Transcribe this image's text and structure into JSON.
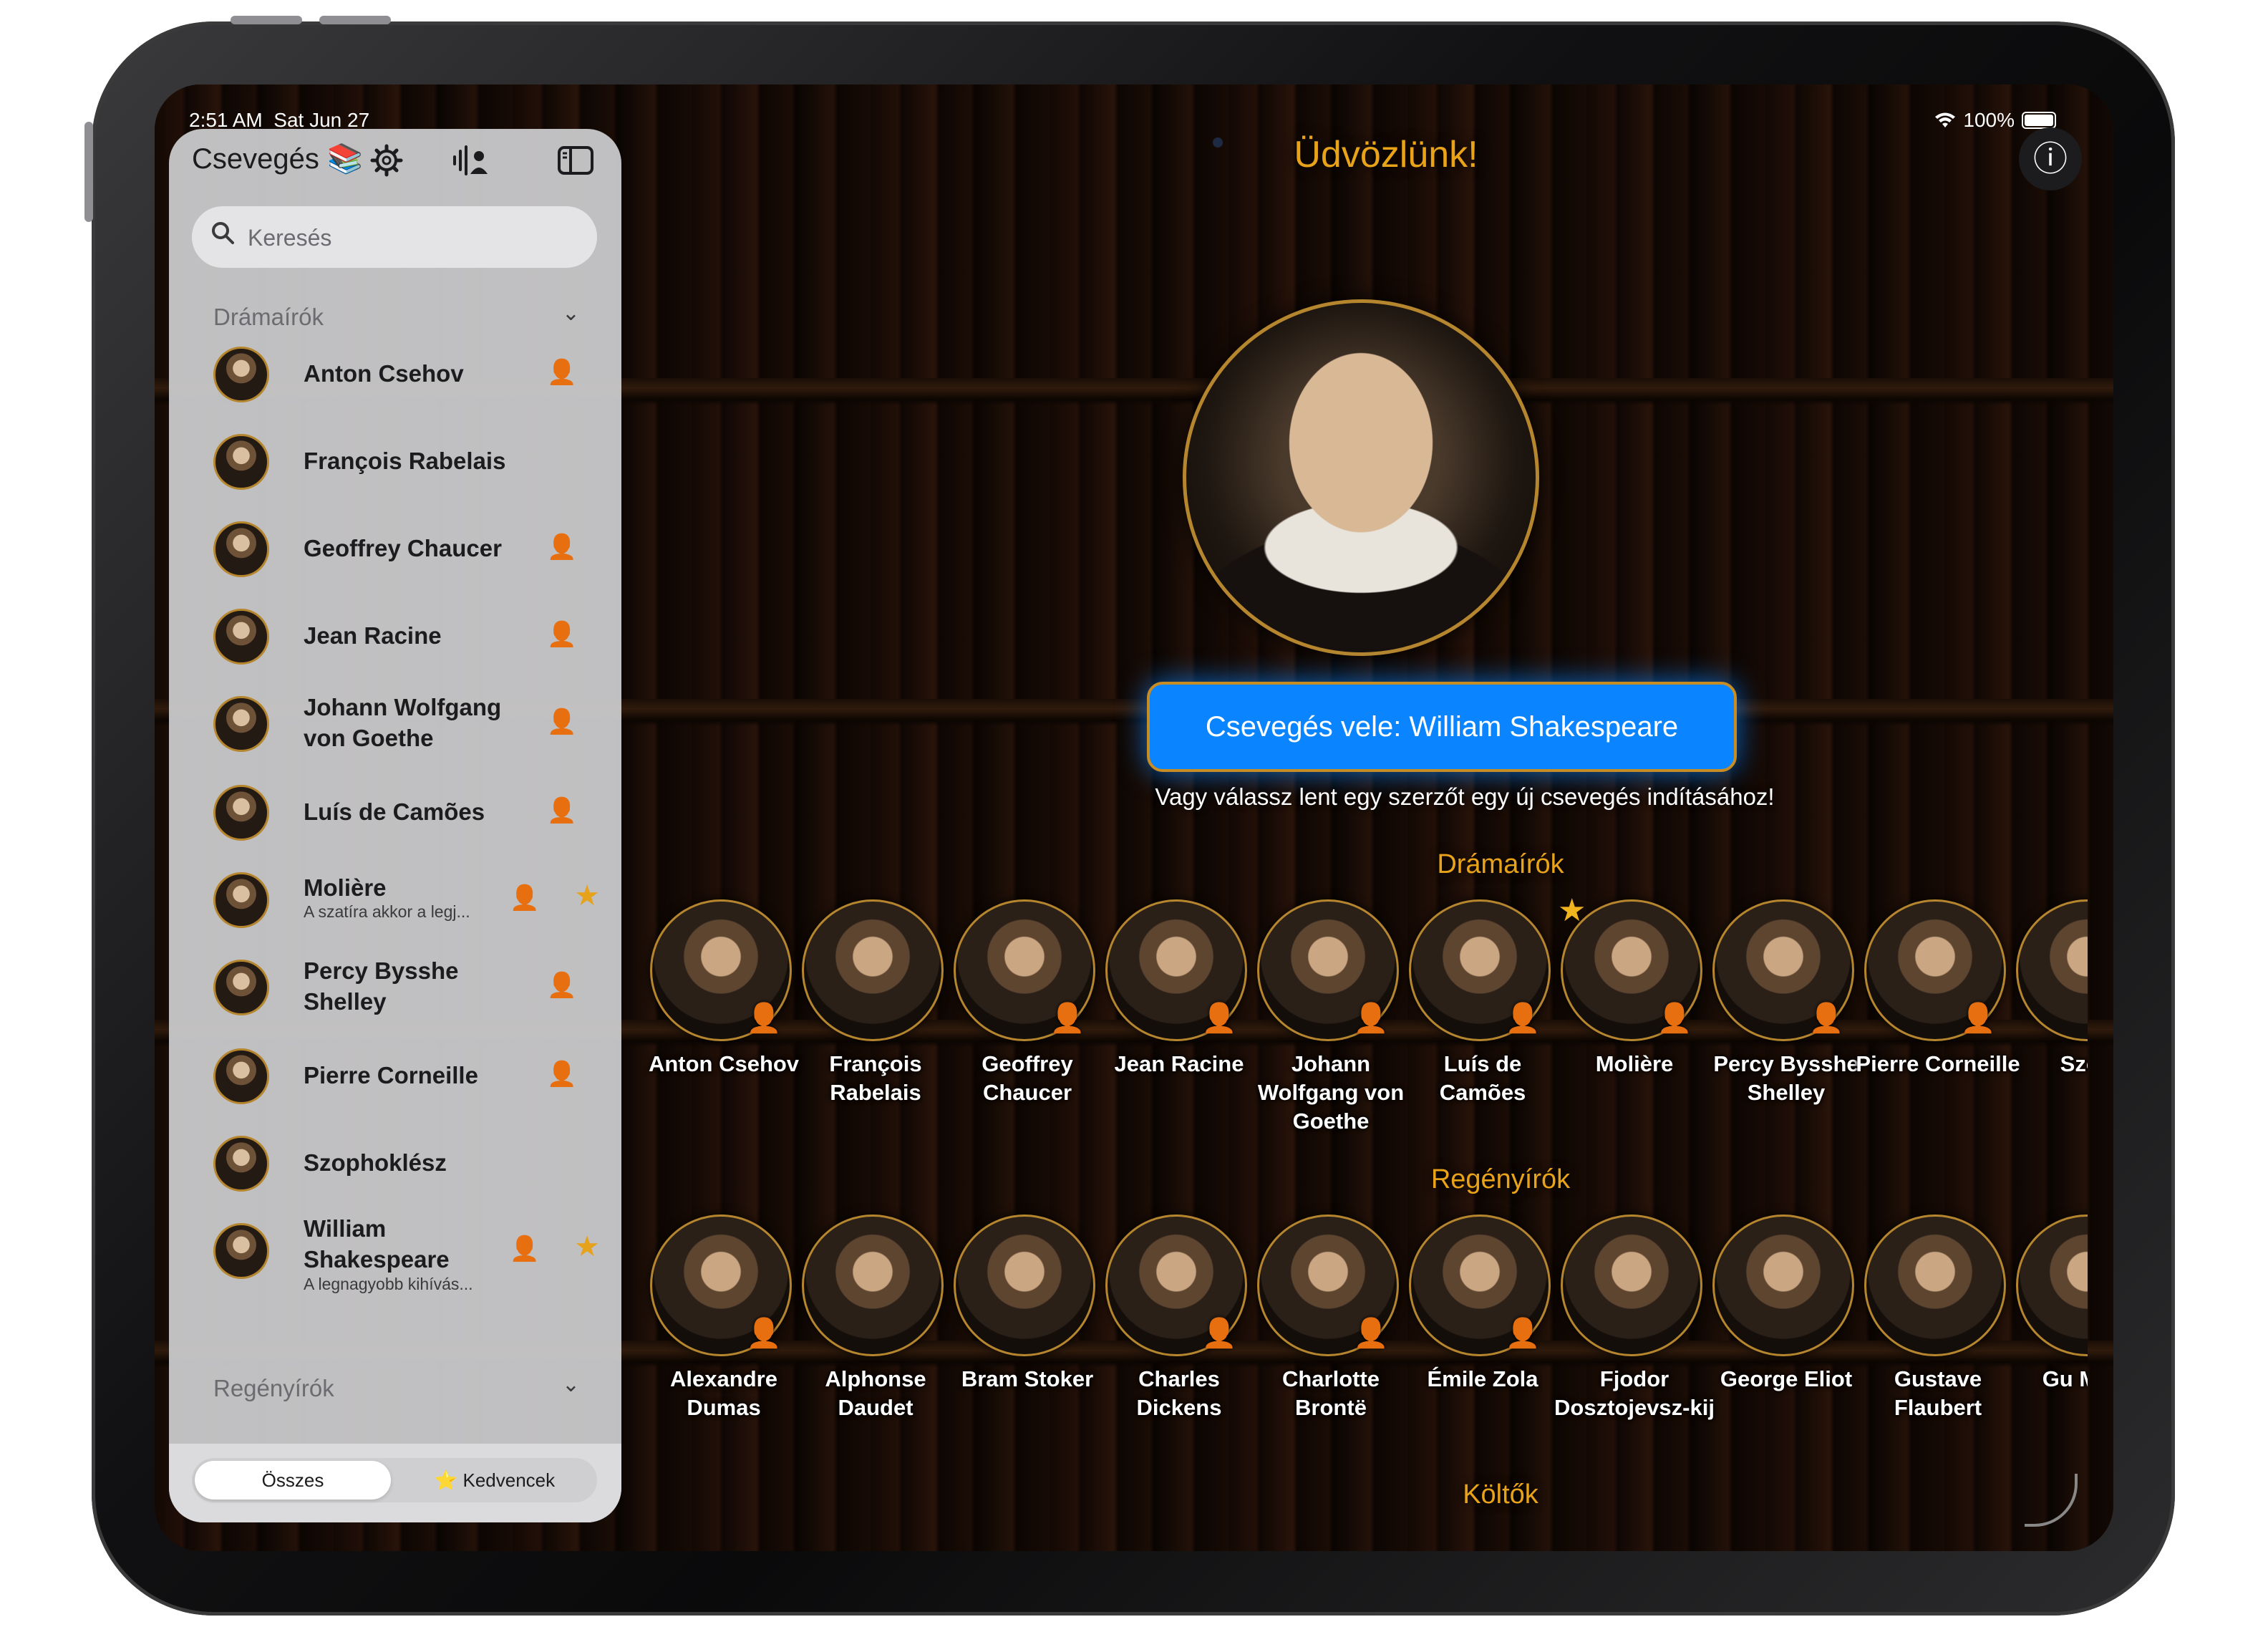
{
  "status": {
    "time": "2:51 AM",
    "date": "Sat Jun 27",
    "battery": "100%"
  },
  "sidebar": {
    "title": "Csevegés 📚",
    "icons": [
      "gear-icon",
      "voice-contact-icon",
      "sidebar-toggle-icon"
    ],
    "search_placeholder": "Keresés",
    "sections": [
      {
        "title": "Drámaírók",
        "items": [
          {
            "name": "Anton Csehov",
            "voice": true,
            "favorite": false,
            "subtitle": ""
          },
          {
            "name": "François Rabelais",
            "voice": false,
            "favorite": false,
            "subtitle": ""
          },
          {
            "name": "Geoffrey Chaucer",
            "voice": true,
            "favorite": false,
            "subtitle": ""
          },
          {
            "name": "Jean Racine",
            "voice": true,
            "favorite": false,
            "subtitle": ""
          },
          {
            "name": "Johann Wolfgang von Goethe",
            "voice": true,
            "favorite": false,
            "subtitle": ""
          },
          {
            "name": "Luís de Camões",
            "voice": true,
            "favorite": false,
            "subtitle": ""
          },
          {
            "name": "Molière",
            "voice": true,
            "favorite": true,
            "subtitle": "A szatíra akkor a legj..."
          },
          {
            "name": "Percy Bysshe Shelley",
            "voice": true,
            "favorite": false,
            "subtitle": ""
          },
          {
            "name": "Pierre Corneille",
            "voice": true,
            "favorite": false,
            "subtitle": ""
          },
          {
            "name": "Szophoklész",
            "voice": false,
            "favorite": false,
            "subtitle": ""
          },
          {
            "name": "William Shakespeare",
            "voice": true,
            "favorite": true,
            "subtitle": "A legnagyobb kihívás..."
          }
        ]
      },
      {
        "title": "Regényírók",
        "items": []
      }
    ],
    "segments": {
      "all": "Összes",
      "favorites": "⭐ Kedvencek",
      "selected": "Összes"
    }
  },
  "main": {
    "title": "Üdvözlünk!",
    "cta": "Csevegés vele: William Shakespeare",
    "subtitle": "Vagy válassz lent egy szerzőt egy új csevegés indításához!",
    "categories": [
      {
        "title": "Drámaírók",
        "authors": [
          {
            "name": "Anton Csehov",
            "voice": true,
            "favorite": false
          },
          {
            "name": "François Rabelais",
            "voice": false,
            "favorite": false
          },
          {
            "name": "Geoffrey Chaucer",
            "voice": true,
            "favorite": false
          },
          {
            "name": "Jean Racine",
            "voice": true,
            "favorite": false
          },
          {
            "name": "Johann Wolfgang von Goethe",
            "voice": true,
            "favorite": false
          },
          {
            "name": "Luís de Camões",
            "voice": true,
            "favorite": false
          },
          {
            "name": "Molière",
            "voice": true,
            "favorite": true
          },
          {
            "name": "Percy Bysshe Shelley",
            "voice": true,
            "favorite": false
          },
          {
            "name": "Pierre Corneille",
            "voice": true,
            "favorite": false
          },
          {
            "name": "Szopl",
            "voice": false,
            "favorite": false
          }
        ]
      },
      {
        "title": "Regényírók",
        "authors": [
          {
            "name": "Alexandre Dumas",
            "voice": true,
            "favorite": false
          },
          {
            "name": "Alphonse Daudet",
            "voice": false,
            "favorite": false
          },
          {
            "name": "Bram Stoker",
            "voice": false,
            "favorite": false
          },
          {
            "name": "Charles Dickens",
            "voice": true,
            "favorite": false
          },
          {
            "name": "Charlotte Brontë",
            "voice": true,
            "favorite": false
          },
          {
            "name": "Émile Zola",
            "voice": true,
            "favorite": false
          },
          {
            "name": "Fjodor Dosztojevsz-kij",
            "voice": false,
            "favorite": false
          },
          {
            "name": "George Eliot",
            "voice": false,
            "favorite": false
          },
          {
            "name": "Gustave Flaubert",
            "voice": false,
            "favorite": false
          },
          {
            "name": "Gu Maup",
            "voice": false,
            "favorite": false
          }
        ]
      },
      {
        "title": "Költők",
        "authors": []
      }
    ]
  },
  "colors": {
    "accent": "#e8a319",
    "cta": "#0a84ff",
    "avatar_ring": "#b5862e"
  }
}
